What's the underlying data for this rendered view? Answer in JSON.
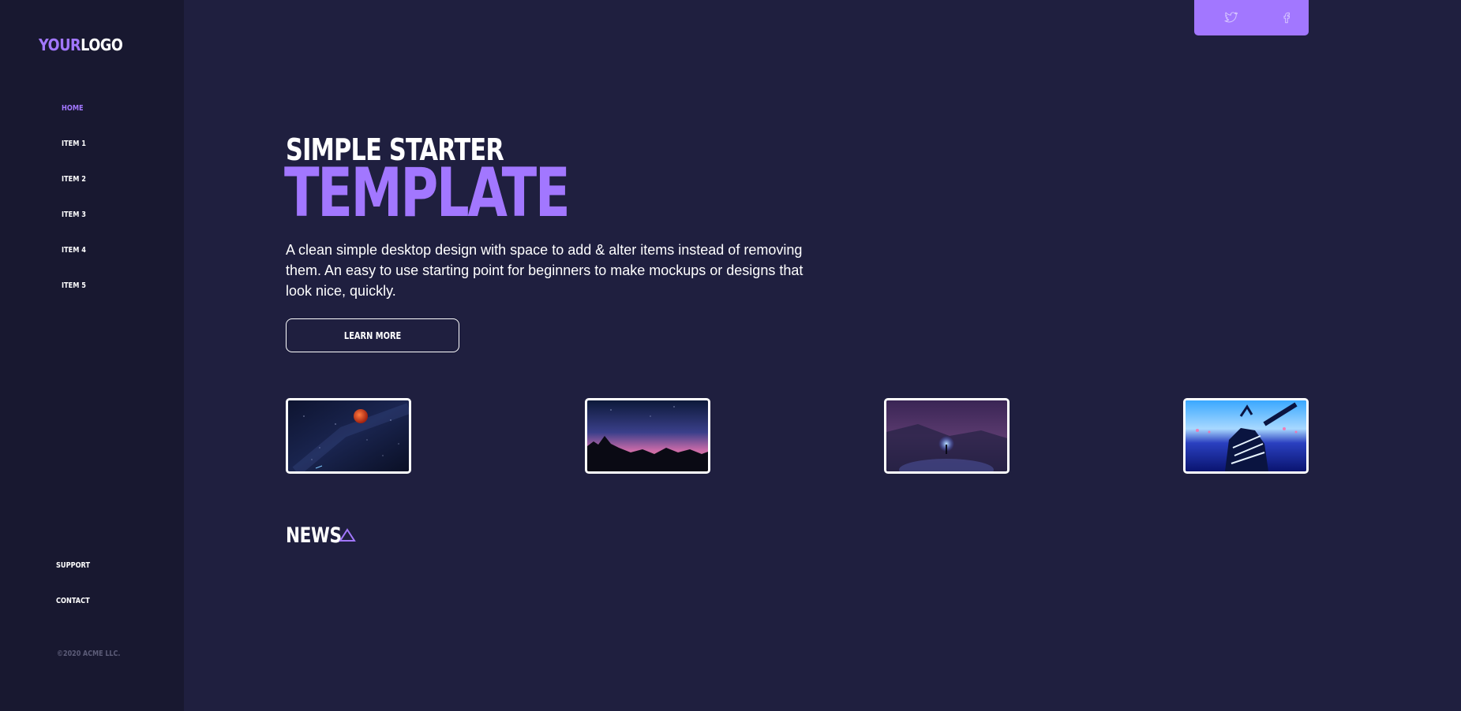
{
  "logo": {
    "part1": "YOUR",
    "part2": "LOGO"
  },
  "sidebar": {
    "nav": [
      {
        "label": "HOME",
        "active": true
      },
      {
        "label": "ITEM 1"
      },
      {
        "label": "ITEM 2"
      },
      {
        "label": "ITEM 3"
      },
      {
        "label": "ITEM 4"
      },
      {
        "label": "ITEM  5"
      }
    ],
    "bottom": [
      {
        "label": "SUPPORT"
      },
      {
        "label": "CONTACT"
      }
    ],
    "copyright": "©2020 ACME LLC."
  },
  "social": {
    "icons": [
      "twitter-icon",
      "facebook-icon"
    ]
  },
  "hero": {
    "title_line1": "SIMPLE STARTER",
    "title_line2": "TEMPLATE",
    "description": "A clean simple desktop design with space to add & alter items instead of removing them. An easy to use starting point for beginners to make mockups or designs that look nice, quickly.",
    "button_label": "LEARN MORE"
  },
  "gallery": {
    "items": [
      {
        "name": "red-moon-night-sky"
      },
      {
        "name": "purple-sunset-rocks"
      },
      {
        "name": "light-painting-snow"
      },
      {
        "name": "neon-figure-city"
      }
    ]
  },
  "news": {
    "title": "NEWS"
  },
  "colors": {
    "accent": "#a277ff",
    "background": "#1f1f3f",
    "sidebar": "#181830"
  }
}
